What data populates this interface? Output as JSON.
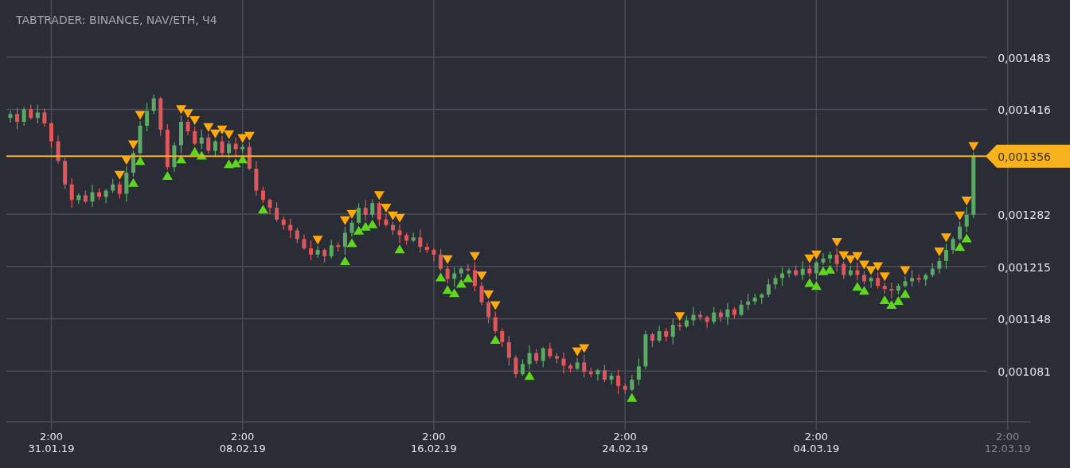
{
  "chart": {
    "title": "TABTRADER: BINANCE, NAV/ETH, Ч4",
    "chart_data": {
      "type": "candlestick",
      "categories": [
        null,
        null,
        null,
        null,
        null,
        null,
        "2:00\n31.01.19",
        null,
        null,
        null,
        null,
        null,
        null,
        null,
        null,
        null,
        null,
        null,
        null,
        null,
        null,
        null,
        null,
        null,
        null,
        null,
        null,
        null,
        null,
        null,
        null,
        null,
        null,
        null,
        "2:00\n08.02.19",
        null,
        null,
        null,
        null,
        null,
        null,
        null,
        null,
        null,
        null,
        null,
        null,
        null,
        null,
        null,
        null,
        null,
        null,
        null,
        null,
        null,
        null,
        null,
        null,
        null,
        null,
        null,
        "2:00\n16.02.19",
        null,
        null,
        null,
        null,
        null,
        null,
        null,
        null,
        null,
        null,
        null,
        null,
        null,
        null,
        null,
        null,
        null,
        null,
        null,
        null,
        null,
        null,
        null,
        null,
        null,
        null,
        null,
        "2:00\n24.02.19",
        null,
        null,
        null,
        null,
        null,
        null,
        null,
        null,
        null,
        null,
        null,
        null,
        null,
        null,
        null,
        null,
        null,
        null,
        null,
        null,
        null,
        null,
        null,
        null,
        null,
        null,
        null,
        "2:00\n04.03.19",
        null,
        null,
        null,
        null,
        null,
        null,
        null,
        null,
        null,
        null,
        null,
        null,
        null,
        null,
        null,
        null,
        null,
        null,
        null,
        null,
        null,
        null,
        null,
        null,
        null,
        null,
        null,
        "2:00\n12.03.19"
      ],
      "ohlc": [
        [
          0.001405,
          0.001414,
          0.001399,
          0.00141
        ],
        [
          0.00141,
          0.001418,
          0.00139,
          0.0014
        ],
        [
          0.0014,
          0.001419,
          0.001395,
          0.001416
        ],
        [
          0.001416,
          0.001422,
          0.001403,
          0.001405
        ],
        [
          0.001405,
          0.001422,
          0.001398,
          0.001412
        ],
        [
          0.001412,
          0.001417,
          0.001394,
          0.001398
        ],
        [
          0.001398,
          0.0014,
          0.001367,
          0.001375
        ],
        [
          0.001375,
          0.001382,
          0.001347,
          0.00135
        ],
        [
          0.00135,
          0.001354,
          0.001314,
          0.00132
        ],
        [
          0.00132,
          0.001328,
          0.00129,
          0.0013
        ],
        [
          0.0013,
          0.001309,
          0.001295,
          0.001306
        ],
        [
          0.001306,
          0.001312,
          0.001296,
          0.001298
        ],
        [
          0.001298,
          0.00132,
          0.001291,
          0.00131
        ],
        [
          0.00131,
          0.001315,
          0.0013,
          0.001304
        ],
        [
          0.001304,
          0.001314,
          0.001296,
          0.001312
        ],
        [
          0.001312,
          0.001327,
          0.001309,
          0.00132
        ],
        [
          0.00132,
          0.001324,
          0.001302,
          0.001308
        ],
        [
          0.001308,
          0.001343,
          0.001298,
          0.001335
        ],
        [
          0.001335,
          0.001363,
          0.00133,
          0.00136
        ],
        [
          0.00136,
          0.001401,
          0.001358,
          0.001395
        ],
        [
          0.001395,
          0.001424,
          0.001388,
          0.001414
        ],
        [
          0.001414,
          0.001435,
          0.00141,
          0.00143
        ],
        [
          0.00143,
          0.001432,
          0.001382,
          0.00139
        ],
        [
          0.00139,
          0.001397,
          0.001339,
          0.001342
        ],
        [
          0.001342,
          0.001374,
          0.001336,
          0.00137
        ],
        [
          0.00137,
          0.001408,
          0.00136,
          0.0014
        ],
        [
          0.0014,
          0.001403,
          0.001383,
          0.001388
        ],
        [
          0.001388,
          0.001394,
          0.00137,
          0.001372
        ],
        [
          0.001372,
          0.00139,
          0.001365,
          0.00138
        ],
        [
          0.00138,
          0.001385,
          0.001359,
          0.001363
        ],
        [
          0.001363,
          0.001377,
          0.001355,
          0.001375
        ],
        [
          0.001375,
          0.001382,
          0.001357,
          0.00136
        ],
        [
          0.00136,
          0.001376,
          0.001354,
          0.001372
        ],
        [
          0.001372,
          0.00138,
          0.001355,
          0.001365
        ],
        [
          0.001365,
          0.001371,
          0.00136,
          0.001368
        ],
        [
          0.001368,
          0.001374,
          0.001338,
          0.00134
        ],
        [
          0.00134,
          0.00135,
          0.001305,
          0.001312
        ],
        [
          0.001312,
          0.001317,
          0.001296,
          0.0013
        ],
        [
          0.0013,
          0.001302,
          0.001282,
          0.00129
        ],
        [
          0.00129,
          0.001297,
          0.001272,
          0.001275
        ],
        [
          0.001275,
          0.001279,
          0.001262,
          0.001268
        ],
        [
          0.001268,
          0.001276,
          0.001251,
          0.001261
        ],
        [
          0.001261,
          0.001264,
          0.001245,
          0.00125
        ],
        [
          0.00125,
          0.001256,
          0.001236,
          0.001238
        ],
        [
          0.001238,
          0.001248,
          0.001223,
          0.00123
        ],
        [
          0.00123,
          0.001241,
          0.001226,
          0.001236
        ],
        [
          0.001236,
          0.001238,
          0.00122,
          0.001228
        ],
        [
          0.001228,
          0.001249,
          0.001225,
          0.001242
        ],
        [
          0.001242,
          0.001246,
          0.001234,
          0.00124
        ],
        [
          0.00124,
          0.001266,
          0.00123,
          0.001258
        ],
        [
          0.001258,
          0.001274,
          0.001253,
          0.001271
        ],
        [
          0.001271,
          0.001296,
          0.001269,
          0.00129
        ],
        [
          0.00129,
          0.0013,
          0.001274,
          0.001281
        ],
        [
          0.001281,
          0.001301,
          0.001277,
          0.001296
        ],
        [
          0.001296,
          0.001298,
          0.001267,
          0.001275
        ],
        [
          0.001275,
          0.001282,
          0.001265,
          0.001268
        ],
        [
          0.001268,
          0.001272,
          0.001255,
          0.001261
        ],
        [
          0.001261,
          0.001269,
          0.001245,
          0.001255
        ],
        [
          0.001255,
          0.001258,
          0.001243,
          0.001248
        ],
        [
          0.001248,
          0.001258,
          0.001246,
          0.001252
        ],
        [
          0.001252,
          0.001262,
          0.001233,
          0.00124
        ],
        [
          0.00124,
          0.001245,
          0.001232,
          0.001236
        ],
        [
          0.001236,
          0.001238,
          0.001222,
          0.00123
        ],
        [
          0.00123,
          0.001237,
          0.001209,
          0.001212
        ],
        [
          0.001212,
          0.001216,
          0.001193,
          0.001199
        ],
        [
          0.001199,
          0.001214,
          0.001189,
          0.001206
        ],
        [
          0.001206,
          0.001215,
          0.001201,
          0.001212
        ],
        [
          0.001212,
          0.001218,
          0.001208,
          0.00121
        ],
        [
          0.00121,
          0.00122,
          0.001183,
          0.00119
        ],
        [
          0.00119,
          0.001195,
          0.001165,
          0.001169
        ],
        [
          0.001169,
          0.001171,
          0.001142,
          0.00115
        ],
        [
          0.00115,
          0.001157,
          0.001129,
          0.001132
        ],
        [
          0.001132,
          0.001136,
          0.001112,
          0.001118
        ],
        [
          0.001118,
          0.001126,
          0.001088,
          0.001098
        ],
        [
          0.001098,
          0.001101,
          0.001072,
          0.001077
        ],
        [
          0.001077,
          0.001096,
          0.001075,
          0.00109
        ],
        [
          0.00109,
          0.001114,
          0.001083,
          0.001104
        ],
        [
          0.001104,
          0.001109,
          0.00109,
          0.001094
        ],
        [
          0.001094,
          0.001112,
          0.001086,
          0.00111
        ],
        [
          0.00111,
          0.001117,
          0.001097,
          0.0011
        ],
        [
          0.0011,
          0.001104,
          0.001091,
          0.001097
        ],
        [
          0.001097,
          0.001105,
          0.001078,
          0.001088
        ],
        [
          0.001088,
          0.001091,
          0.001079,
          0.001084
        ],
        [
          0.001084,
          0.001098,
          0.001082,
          0.001092
        ],
        [
          0.001092,
          0.001102,
          0.001073,
          0.00108
        ],
        [
          0.00108,
          0.001085,
          0.001073,
          0.001077
        ],
        [
          0.001077,
          0.001084,
          0.001069,
          0.001082
        ],
        [
          0.001082,
          0.001089,
          0.001067,
          0.00107
        ],
        [
          0.00107,
          0.001079,
          0.001064,
          0.001075
        ],
        [
          0.001075,
          0.001083,
          0.001052,
          0.001062
        ],
        [
          0.001062,
          0.001065,
          0.001052,
          0.001057
        ],
        [
          0.001057,
          0.001076,
          0.001055,
          0.00107
        ],
        [
          0.00107,
          0.001097,
          0.001063,
          0.001087
        ],
        [
          0.001087,
          0.001133,
          0.001083,
          0.001128
        ],
        [
          0.001128,
          0.00113,
          0.001112,
          0.00112
        ],
        [
          0.00112,
          0.001139,
          0.001117,
          0.001132
        ],
        [
          0.001132,
          0.001136,
          0.001119,
          0.001125
        ],
        [
          0.001125,
          0.001148,
          0.001115,
          0.00114
        ],
        [
          0.00114,
          0.001143,
          0.001133,
          0.001138
        ],
        [
          0.001138,
          0.001152,
          0.001136,
          0.001146
        ],
        [
          0.001146,
          0.001163,
          0.001139,
          0.001153
        ],
        [
          0.001153,
          0.001158,
          0.001146,
          0.00115
        ],
        [
          0.00115,
          0.001152,
          0.001136,
          0.001144
        ],
        [
          0.001144,
          0.001163,
          0.001141,
          0.001156
        ],
        [
          0.001156,
          0.00116,
          0.001144,
          0.00115
        ],
        [
          0.00115,
          0.001168,
          0.00114,
          0.00116
        ],
        [
          0.00116,
          0.001163,
          0.001148,
          0.001153
        ],
        [
          0.001153,
          0.001172,
          0.001151,
          0.001166
        ],
        [
          0.001166,
          0.00118,
          0.001159,
          0.00117
        ],
        [
          0.00117,
          0.00118,
          0.001166,
          0.001175
        ],
        [
          0.001175,
          0.001181,
          0.001167,
          0.001179
        ],
        [
          0.001179,
          0.001199,
          0.001176,
          0.001192
        ],
        [
          0.001192,
          0.001204,
          0.001186,
          0.0012
        ],
        [
          0.0012,
          0.001214,
          0.00119,
          0.001206
        ],
        [
          0.001206,
          0.001213,
          0.001201,
          0.00121
        ],
        [
          0.00121,
          0.001216,
          0.001202,
          0.001204
        ],
        [
          0.001204,
          0.001222,
          0.001197,
          0.001212
        ],
        [
          0.001212,
          0.001217,
          0.001202,
          0.001206
        ],
        [
          0.001206,
          0.001222,
          0.001198,
          0.00122
        ],
        [
          0.00122,
          0.001232,
          0.001217,
          0.001225
        ],
        [
          0.001225,
          0.001234,
          0.001219,
          0.00123
        ],
        [
          0.00123,
          0.001238,
          0.001208,
          0.001218
        ],
        [
          0.001218,
          0.001221,
          0.001199,
          0.001204
        ],
        [
          0.001204,
          0.001216,
          0.001202,
          0.00121
        ],
        [
          0.00121,
          0.00122,
          0.001197,
          0.001204
        ],
        [
          0.001204,
          0.001209,
          0.001192,
          0.001196
        ],
        [
          0.001196,
          0.001202,
          0.001188,
          0.0012
        ],
        [
          0.0012,
          0.001207,
          0.001187,
          0.00119
        ],
        [
          0.00119,
          0.001194,
          0.00118,
          0.001186
        ],
        [
          0.001186,
          0.001194,
          0.001174,
          0.001184
        ],
        [
          0.001184,
          0.001193,
          0.001179,
          0.00119
        ],
        [
          0.00119,
          0.001202,
          0.001188,
          0.001196
        ],
        [
          0.001196,
          0.00121,
          0.001189,
          0.0012
        ],
        [
          0.0012,
          0.001205,
          0.001194,
          0.001198
        ],
        [
          0.001198,
          0.001206,
          0.00119,
          0.001204
        ],
        [
          0.001204,
          0.001219,
          0.001201,
          0.001212
        ],
        [
          0.001212,
          0.001226,
          0.001206,
          0.001222
        ],
        [
          0.001222,
          0.001244,
          0.001212,
          0.001236
        ],
        [
          0.001236,
          0.001253,
          0.001231,
          0.00125
        ],
        [
          0.00125,
          0.001272,
          0.001248,
          0.001266
        ],
        [
          0.001266,
          0.001291,
          0.001259,
          0.001281
        ],
        [
          0.001281,
          0.001361,
          0.001277,
          0.001356
        ],
        null,
        null,
        null,
        null,
        null
      ],
      "ylim": [
        0.001016,
        0.001556
      ],
      "grid": true,
      "yticks": [
        {
          "value": 0.001483,
          "label": "0,001483"
        },
        {
          "value": 0.001416,
          "label": "0,001416"
        },
        {
          "value": 0.001282,
          "label": "0,001282"
        },
        {
          "value": 0.001215,
          "label": "0,001215"
        },
        {
          "value": 0.001148,
          "label": "0,001148"
        },
        {
          "value": 0.001081,
          "label": "0,001081"
        }
      ]
    },
    "current_price": {
      "label": "0,001356"
    }
  }
}
